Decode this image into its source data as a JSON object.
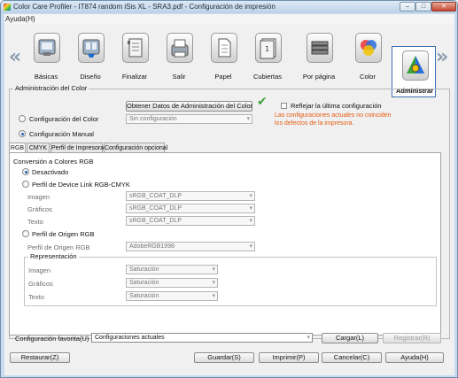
{
  "window": {
    "title": "Color Care Profiler - IT874 random iSis XL - SRA3.pdf - Configuración de impresión",
    "minimize": "–",
    "maximize": "□",
    "close": "✕"
  },
  "menu": {
    "help": "Ayuda(H)"
  },
  "toolbar": {
    "prev_arrow": "«",
    "next_arrow": "»",
    "items": [
      {
        "label": "Básicas",
        "icon": "basics-icon"
      },
      {
        "label": "Diseño",
        "icon": "layout-icon"
      },
      {
        "label": "Finalizar",
        "icon": "finishing-icon"
      },
      {
        "label": "Salir",
        "icon": "output-icon"
      },
      {
        "label": "Papel",
        "icon": "paper-icon"
      },
      {
        "label": "Cubiertas",
        "icon": "covers-icon"
      },
      {
        "label": "Por página",
        "icon": "per-page-icon"
      },
      {
        "label": "Color",
        "icon": "color-icon"
      },
      {
        "label": "Administrar",
        "icon": "administer-icon"
      }
    ]
  },
  "color_management": {
    "legend": "Administración del Color",
    "get_data_button": "Obtener Datos de Administración del Color",
    "reflect_last": "Reflejar la última configuración",
    "config_color_label": "Configuración del Color",
    "config_color_value": "Sin configuración",
    "warning_line1": "Las configuraciones actuales no coinciden",
    "warning_line2": "los defectos de la impresora.",
    "manual_label": "Configuración Manual",
    "tabs": [
      "RGB",
      "CMYK",
      "Perfil de Impresora",
      "Configuración opcional"
    ],
    "rgb_conversion_legend": "Conversión a Colores RGB",
    "disabled_label": "Desactivado",
    "device_link_label": "Perfil de Device Link RGB-CMYK",
    "image_label": "Imagen",
    "graphics_label": "Gráficos",
    "text_label": "Texto",
    "image_value": "sRGB_COAT_DLP",
    "graphics_value": "sRGB_COAT_DLP",
    "text_value": "sRGB_COAT_DLP",
    "origin_profile_label": "Perfil de Origen RGB",
    "origin_profile_field_label": "Perfil de Origen RGB",
    "origin_profile_value": "AdobeRGB1998",
    "representation_legend": "Representación",
    "rep_image_label": "Imagen",
    "rep_graphics_label": "Gráficos",
    "rep_text_label": "Texto",
    "rep_image_value": "Saturación",
    "rep_graphics_value": "Saturación",
    "rep_text_value": "Saturación"
  },
  "favorites": {
    "label": "Configuración favorita(U)",
    "value": "Configuraciones actuales",
    "load_button": "Cargar(L)",
    "register_button": "Registrar(R)"
  },
  "footer": {
    "restore": "Restaurar(Z)",
    "save": "Guardar(S)",
    "print": "Imprimir(P)",
    "cancel": "Cancelar(C)",
    "help": "Ayuda(H)"
  }
}
